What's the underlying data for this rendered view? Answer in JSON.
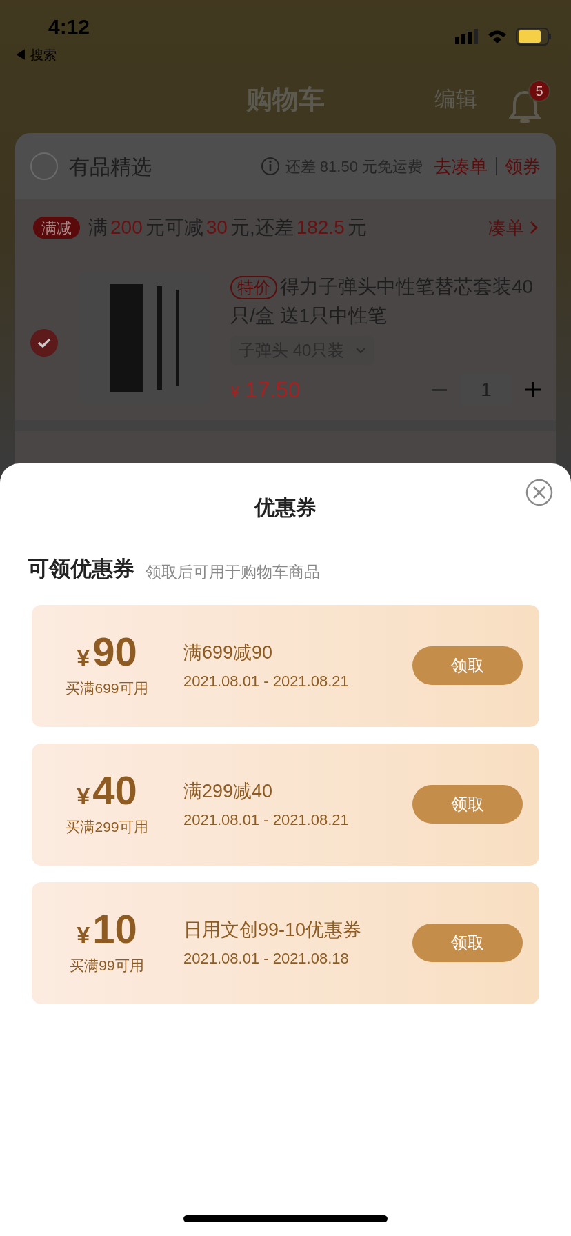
{
  "status_bar": {
    "time": "4:12",
    "back_label": "◀ 搜索"
  },
  "header": {
    "title": "购物车",
    "edit": "编辑",
    "notification_count": "5"
  },
  "store": {
    "name": "有品精选",
    "checked": false,
    "shipping_note": "还差 81.50 元免运费",
    "add_on": "去凑单",
    "coupons_link": "领券"
  },
  "promotion": {
    "tag": "满减",
    "parts": [
      {
        "text": "满",
        "highlight": false
      },
      {
        "text": "200",
        "highlight": true
      },
      {
        "text": "元可减",
        "highlight": false
      },
      {
        "text": "30",
        "highlight": true
      },
      {
        "text": "元,还差",
        "highlight": false
      },
      {
        "text": "182.5",
        "highlight": true
      },
      {
        "text": "元",
        "highlight": false
      }
    ],
    "action": "凑单"
  },
  "product": {
    "checked": true,
    "tag": "特价",
    "title": "得力子弹头中性笔替芯套装40只/盒 送1只中性笔",
    "variant": "子弹头 40只装",
    "currency": "¥",
    "price": "17.50",
    "quantity": "1"
  },
  "sheet": {
    "title": "优惠券",
    "section_title": "可领优惠券",
    "section_note": "领取后可用于购物车商品",
    "coupons": [
      {
        "currency": "¥",
        "amount": "90",
        "condition": "买满699可用",
        "name": "满699减90",
        "period": "2021.08.01 - 2021.08.21",
        "button": "领取"
      },
      {
        "currency": "¥",
        "amount": "40",
        "condition": "买满299可用",
        "name": "满299减40",
        "period": "2021.08.01 - 2021.08.21",
        "button": "领取"
      },
      {
        "currency": "¥",
        "amount": "10",
        "condition": "买满99可用",
        "name": "日用文创99-10优惠券",
        "period": "2021.08.01 - 2021.08.18",
        "button": "领取"
      }
    ]
  }
}
